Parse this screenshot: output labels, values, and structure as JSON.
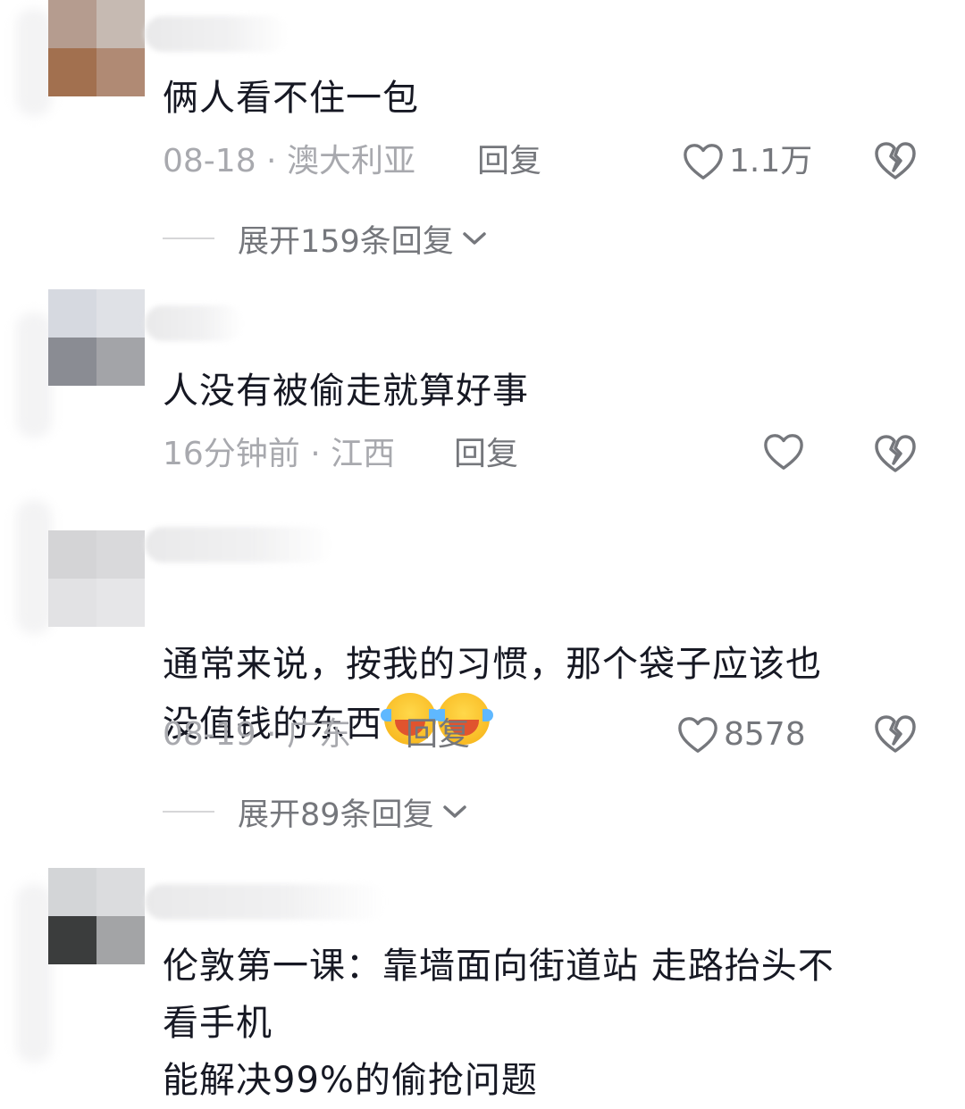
{
  "comments": [
    {
      "text": "俩人看不住一包",
      "date_location": "08-18 · 澳大利亚",
      "reply_label": "回复",
      "likes": "1.1万",
      "expand_label": "展开159条回复"
    },
    {
      "text": "人没有被偷走就算好事",
      "date_location": "16分钟前 · 江西",
      "reply_label": "回复",
      "likes": ""
    },
    {
      "text": "通常来说，按我的习惯，那个袋子应该也\n没值钱的东西",
      "emojis": [
        "laughing-crying-emoji",
        "laughing-crying-emoji"
      ],
      "date_location": "08-19 · 广东",
      "reply_label": "回复",
      "likes": "8578",
      "expand_label": "展开89条回复"
    },
    {
      "text": "伦敦第一课：靠墙面向街道站 走路抬头不\n看手机\n能解决99%的偷抢问题"
    }
  ],
  "icons": {
    "like": "heart-outline-icon",
    "dislike": "broken-heart-icon",
    "expand": "chevron-down-icon"
  },
  "colors": {
    "text": "#161823",
    "meta": "#a8a9ae",
    "action": "#75777c"
  }
}
